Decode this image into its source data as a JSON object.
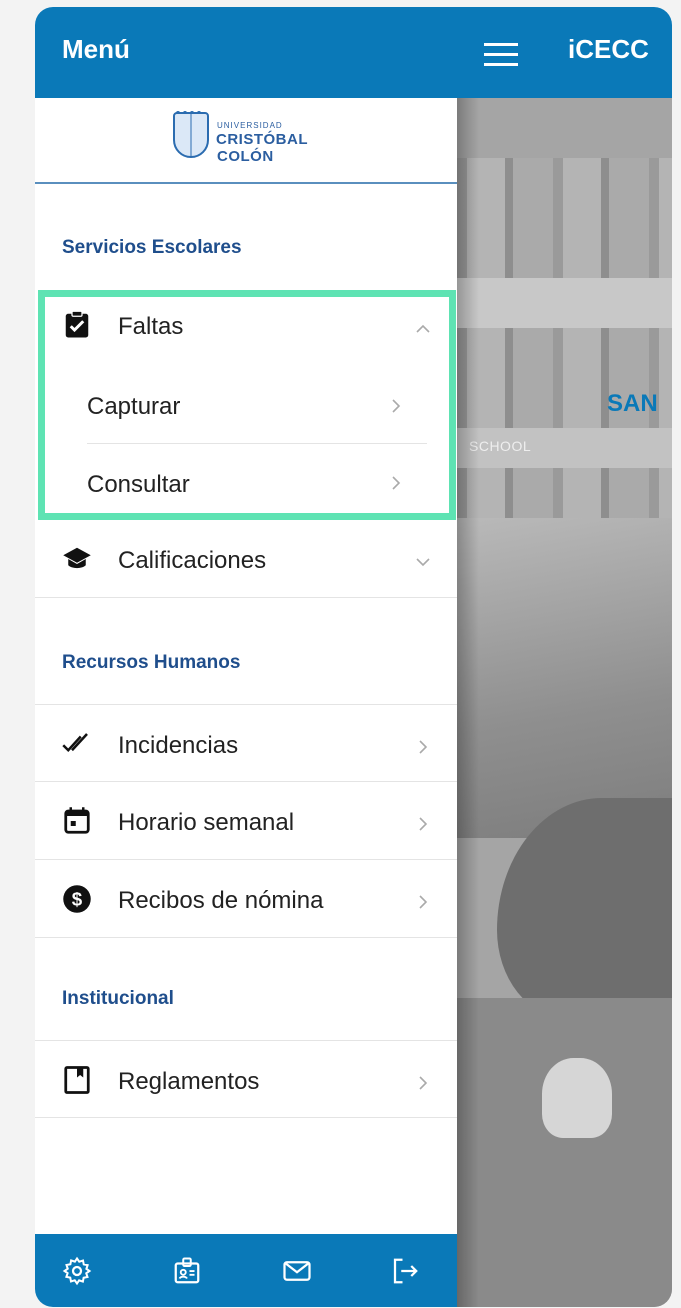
{
  "app": {
    "title": "iCECC",
    "hero_text": "SAN",
    "hero_sign": "SCHOOL"
  },
  "drawer": {
    "title": "Menú",
    "logo": {
      "line1": "UNIVERSIDAD",
      "line2": "CRISTÓBAL",
      "line3": "COLÓN"
    },
    "sections": [
      {
        "header": "Servicios Escolares",
        "items": [
          {
            "label": "Faltas",
            "icon": "clipboard-check-icon",
            "state": "expanded",
            "children": [
              {
                "label": "Capturar"
              },
              {
                "label": "Consultar"
              }
            ]
          },
          {
            "label": "Calificaciones",
            "icon": "graduation-cap-icon",
            "state": "collapsed"
          }
        ]
      },
      {
        "header": "Recursos Humanos",
        "items": [
          {
            "label": "Incidencias",
            "icon": "double-check-icon"
          },
          {
            "label": "Horario semanal",
            "icon": "calendar-icon"
          },
          {
            "label": "Recibos de nómina",
            "icon": "dollar-circle-icon"
          }
        ]
      },
      {
        "header": "Institucional",
        "items": [
          {
            "label": "Reglamentos",
            "icon": "bookmark-page-icon"
          }
        ]
      }
    ],
    "bottom_bar": [
      "settings-gear-icon",
      "id-badge-icon",
      "mail-icon",
      "logout-icon"
    ]
  },
  "colors": {
    "primary": "#0a79b8",
    "section_header": "#1f4e8c",
    "highlight": "#5ee3b3"
  }
}
